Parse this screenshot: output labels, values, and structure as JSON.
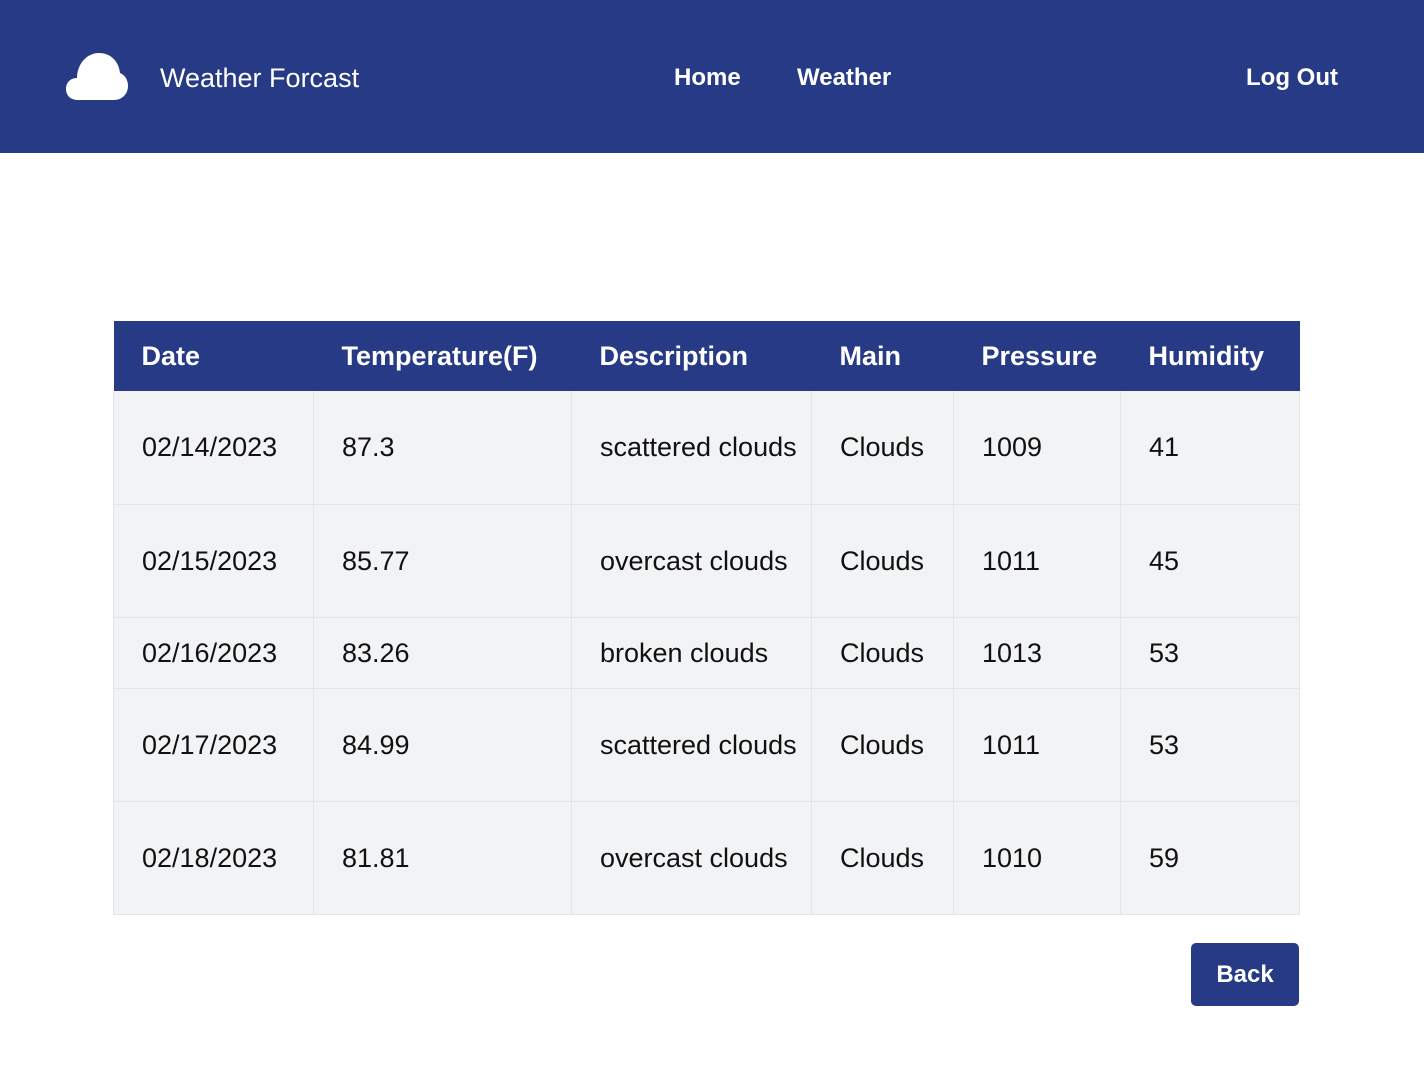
{
  "navbar": {
    "brand_icon": "cloud-icon",
    "brand_title": "Weather Forcast",
    "links": {
      "home": "Home",
      "weather": "Weather",
      "logout": "Log Out"
    }
  },
  "table": {
    "headers": [
      "Date",
      "Temperature(F)",
      "Description",
      "Main",
      "Pressure",
      "Humidity"
    ],
    "rows": [
      [
        "02/14/2023",
        "87.3",
        "scattered clouds",
        "Clouds",
        "1009",
        "41"
      ],
      [
        "02/15/2023",
        "85.77",
        "overcast clouds",
        "Clouds",
        "1011",
        "45"
      ],
      [
        "02/16/2023",
        "83.26",
        "broken clouds",
        "Clouds",
        "1013",
        "53"
      ],
      [
        "02/17/2023",
        "84.99",
        "scattered clouds",
        "Clouds",
        "1011",
        "53"
      ],
      [
        "02/18/2023",
        "81.81",
        "overcast clouds",
        "Clouds",
        "1010",
        "59"
      ]
    ]
  },
  "back_button": "Back",
  "colors": {
    "primary": "#273a85",
    "row_background": "#f2f3f5",
    "text": "#111111"
  }
}
